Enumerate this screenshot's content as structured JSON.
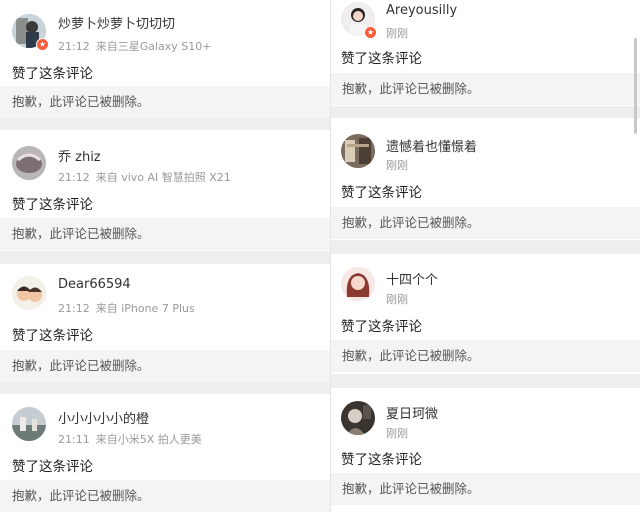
{
  "left_column": [
    {
      "username": "炒萝卜炒萝卜切切切",
      "time": "21:12",
      "source": "来自三星Galaxy S10+",
      "comment": "赞了这条评论",
      "quoted": "抱歉，此评论已被删除。",
      "verified": true
    },
    {
      "username": "乔 zhiz",
      "time": "21:12",
      "source": "来自 vivo AI 智慧拍照 X21",
      "comment": "赞了这条评论",
      "quoted": "抱歉，此评论已被删除。",
      "verified": false
    },
    {
      "username": "Dear66594",
      "time": "21:12",
      "source": "来自 iPhone 7 Plus",
      "comment": "赞了这条评论",
      "quoted": "抱歉，此评论已被删除。",
      "verified": false
    },
    {
      "username": "小小小小小的橙",
      "time": "21:11",
      "source": "来自小米5X 拍人更美",
      "comment": "赞了这条评论",
      "quoted": "抱歉，此评论已被删除。",
      "verified": false
    }
  ],
  "right_column": [
    {
      "username": "Areyousilly",
      "time": "刚刚",
      "comment": "赞了这条评论",
      "quoted": "抱歉，此评论已被删除。",
      "verified": true
    },
    {
      "username": "遗憾着也懂憬着",
      "time": "刚刚",
      "comment": "赞了这条评论",
      "quoted": "抱歉，此评论已被删除。",
      "verified": false
    },
    {
      "username": "十四个个",
      "time": "刚刚",
      "comment": "赞了这条评论",
      "quoted": "抱歉，此评论已被删除。",
      "verified": false
    },
    {
      "username": "夏日珂微",
      "time": "刚刚",
      "comment": "赞了这条评论",
      "quoted": "抱歉，此评论已被删除。",
      "verified": false
    }
  ],
  "colors": {
    "badge": "#ff5a36",
    "separator": "#eeeeee",
    "quote_bg": "#f4f4f4"
  },
  "icons": {
    "verified_badge": "verified-badge-icon"
  }
}
